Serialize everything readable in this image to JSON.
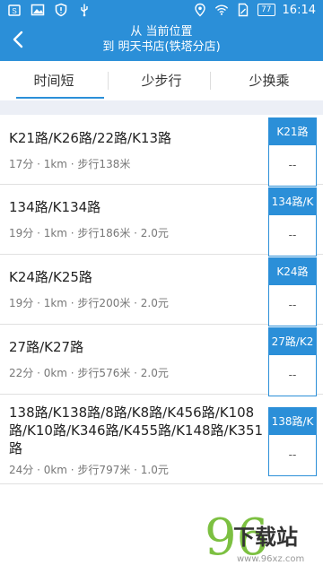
{
  "status_bar": {
    "icons": [
      "app-notification-icon",
      "image-icon",
      "shield-icon",
      "usb-icon"
    ],
    "right_icons": [
      "location-icon",
      "wifi-icon",
      "sim-icon"
    ],
    "battery": "77",
    "time": "16:14"
  },
  "header": {
    "from": "从 当前位置",
    "to": "到 明天书店(铁塔分店)",
    "back_icon": "back-chevron-icon"
  },
  "tabs": [
    {
      "label": "时间短",
      "active": true
    },
    {
      "label": "少步行",
      "active": false
    },
    {
      "label": "少换乘",
      "active": false
    }
  ],
  "routes": [
    {
      "title": "K21路/K26路/22路/K13路",
      "meta": "17分 · 1km · 步行138米",
      "badge": "K21路",
      "badge_sub": "--"
    },
    {
      "title": "134路/K134路",
      "meta": "19分 · 1km · 步行186米 · 2.0元",
      "badge": "134路/K",
      "badge_sub": "--"
    },
    {
      "title": "K24路/K25路",
      "meta": "19分 · 1km · 步行200米 · 2.0元",
      "badge": "K24路",
      "badge_sub": "--"
    },
    {
      "title": "27路/K27路",
      "meta": "22分 · 0km · 步行576米 · 2.0元",
      "badge": "27路/K2",
      "badge_sub": "--"
    },
    {
      "title": "138路/K138路/8路/K8路/K456路/K108路/K10路/K346路/K455路/K148路/K351路",
      "meta": "24分 · 0km · 步行797米 · 1.0元",
      "badge": "138路/K",
      "badge_sub": "--"
    }
  ],
  "watermark": {
    "mark": "96",
    "text": "下载站",
    "url": "www.96xz.com"
  },
  "colors": {
    "accent": "#2b8fd8",
    "gap": "#eceff6",
    "watermark_green": "#7cc041"
  }
}
